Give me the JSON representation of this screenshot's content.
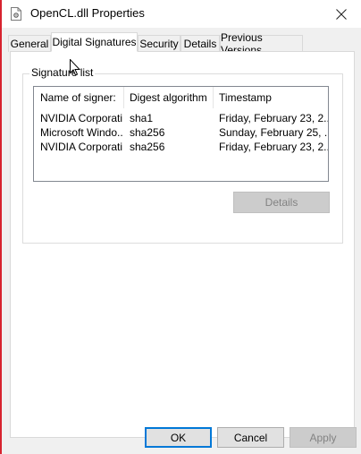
{
  "window": {
    "title": "OpenCL.dll Properties"
  },
  "tabs": [
    {
      "label": "General",
      "selected": false
    },
    {
      "label": "Digital Signatures",
      "selected": true
    },
    {
      "label": "Security",
      "selected": false
    },
    {
      "label": "Details",
      "selected": false
    },
    {
      "label": "Previous Versions",
      "selected": false
    }
  ],
  "signature_list": {
    "group_label": "Signature list",
    "columns": [
      "Name of signer:",
      "Digest algorithm",
      "Timestamp"
    ],
    "rows": [
      {
        "signer": "NVIDIA Corporati...",
        "digest": "sha1",
        "timestamp": "Friday, February 23, 2..."
      },
      {
        "signer": "Microsoft Windo...",
        "digest": "sha256",
        "timestamp": "Sunday, February 25, ..."
      },
      {
        "signer": "NVIDIA Corporati...",
        "digest": "sha256",
        "timestamp": "Friday, February 23, 2..."
      }
    ],
    "details_button": "Details"
  },
  "footer": {
    "ok": "OK",
    "cancel": "Cancel",
    "apply": "Apply"
  },
  "colors": {
    "accent": "#0078d7",
    "window_bg": "#f0f0f0",
    "left_edge": "#d7232f"
  },
  "icons": {
    "title": "document-gear-icon",
    "close": "close-icon",
    "cursor": "mouse-pointer-icon"
  }
}
